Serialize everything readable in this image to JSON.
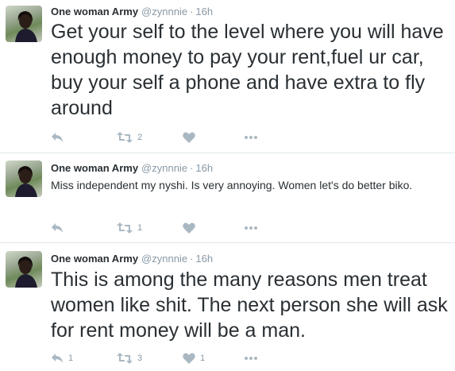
{
  "tweets": [
    {
      "name": "One woman Army",
      "handle": "@zynnnie",
      "separator": "·",
      "time": "16h",
      "text": "Get your self to the level where you will have enough money to pay your rent,fuel ur car, buy your self a phone and have extra to fly around",
      "retweets": "2",
      "likes": "",
      "replies": ""
    },
    {
      "name": "One woman Army",
      "handle": "@zynnnie",
      "separator": "·",
      "time": "16h",
      "text": "Miss independent my nyshi. Is very annoying. Women let's do better biko.",
      "retweets": "1",
      "likes": "",
      "replies": ""
    },
    {
      "name": "One woman Army",
      "handle": "@zynnnie",
      "separator": "·",
      "time": "16h",
      "text": "This is among the many reasons men treat women like shit. The next person she will ask for rent money will be a man.",
      "retweets": "3",
      "likes": "1",
      "replies": "1"
    }
  ],
  "icons": [
    "reply-icon",
    "retweet-icon",
    "like-icon",
    "more-icon"
  ],
  "colors": {
    "icon": "#aab8c2",
    "meta": "#8899a6",
    "text": "#292f33",
    "divider": "#e1e8ed"
  }
}
